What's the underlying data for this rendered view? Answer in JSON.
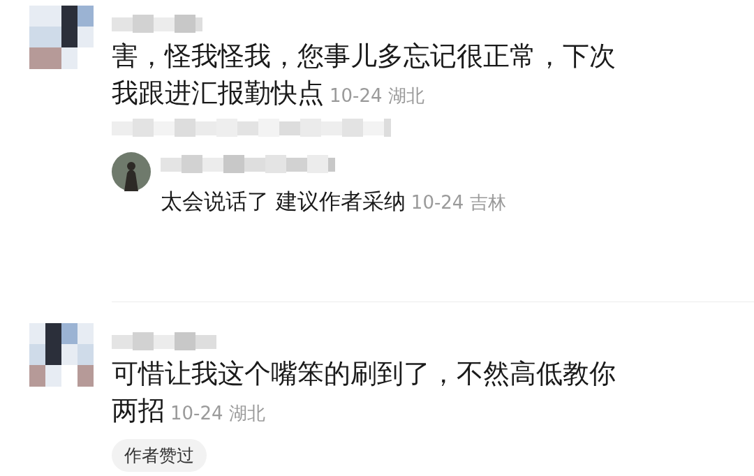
{
  "comments": [
    {
      "text": "害，怪我怪我，您事儿多忘记很正常，下次我跟进汇报勤快点",
      "time": "10-24",
      "location": "湖北",
      "replies": [
        {
          "text": "太会说话了 建议作者采纳",
          "time": "10-24",
          "location": "吉林"
        }
      ]
    },
    {
      "text": "可惜让我这个嘴笨的刷到了，不然高低教你两招",
      "time": "10-24",
      "location": "湖北",
      "badge": "作者赞过"
    }
  ]
}
